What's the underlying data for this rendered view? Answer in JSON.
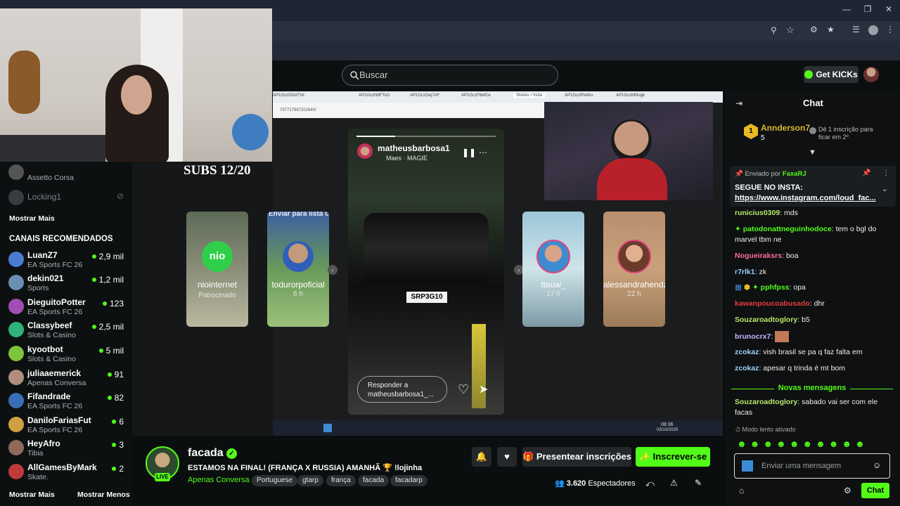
{
  "header": {
    "search_placeholder": "Buscar",
    "get_kicks": "Get KICKs"
  },
  "overlay": {
    "subs": "SUBS 12/20"
  },
  "sidebar": {
    "top_items": [
      {
        "name": "",
        "game": "Assetto Corsa"
      },
      {
        "name": "Locking1",
        "game": ""
      }
    ],
    "show_more_top": "Mostrar Mais",
    "recommended_title": "CANAIS RECOMENDADOS",
    "channels": [
      {
        "name": "LuanZ7",
        "game": "EA Sports FC 26",
        "viewers": "2,9 mil",
        "color": "#4a7bd0"
      },
      {
        "name": "dekin021",
        "game": "Sports",
        "viewers": "1,2 mil",
        "color": "#6b8fb3"
      },
      {
        "name": "DieguitoPotter",
        "game": "EA Sports FC 26",
        "viewers": "123",
        "color": "#a04eb5"
      },
      {
        "name": "Classybeef",
        "game": "Slots & Casino",
        "viewers": "2,5 mil",
        "color": "#2fb37a"
      },
      {
        "name": "kyootbot",
        "game": "Slots & Casino",
        "viewers": "5 mil",
        "color": "#7cc43a"
      },
      {
        "name": "juliaaemerick",
        "game": "Apenas Conversa",
        "viewers": "91",
        "color": "#b08d7c"
      },
      {
        "name": "Fifandrade",
        "game": "EA Sports FC 26",
        "viewers": "82",
        "color": "#3a6fb8"
      },
      {
        "name": "DaniloFariasFut",
        "game": "EA Sports FC 26",
        "viewers": "6",
        "color": "#d0a040"
      },
      {
        "name": "HeyAfro",
        "game": "Tibia",
        "viewers": "3",
        "color": "#8f6a5a"
      },
      {
        "name": "AllGamesByMark",
        "game": "Skate.",
        "viewers": "2",
        "color": "#c13a3a"
      }
    ],
    "show_more": "Mostrar Mais",
    "show_less": "Mostrar Menos"
  },
  "capture": {
    "tabs": [
      "AP1GczOOd7Vk",
      "AP1GczN8FTsO",
      "AP1GczOej7AF",
      "AP1GczF8efCe",
      "Stories • Insta",
      "AP1GczRVeKu",
      "AP1GczMNogk"
    ],
    "url": "797717967202640/",
    "stories": [
      {
        "name": "niointernet",
        "sub": "Patrocinado",
        "logo": "nio"
      },
      {
        "name": "todurorpoficial",
        "sub": "6 h",
        "top": "Enviar para lista c"
      },
      {
        "name": "tteuw_",
        "sub": "17 h"
      },
      {
        "name": "alessandrahendz",
        "sub": "22 h"
      }
    ],
    "center": {
      "user": "matheusbarbosa1",
      "song": "Maes · MAGIE",
      "reply": "Responder a matheusbarbosa1_...",
      "plate": "SRP3G10"
    },
    "clock": "08:36",
    "date": "03/10/2025"
  },
  "stream": {
    "channel": "facada",
    "title": "ESTAMOS NA FINAL! (FRANÇA X RUSSIA) AMANHÃ 🏆 !lojinha",
    "category": "Apenas Conversa",
    "tags": [
      "Portuguese",
      "gtarp",
      "frança",
      "facada",
      "facadarp"
    ],
    "live": "LIVE",
    "gift_label": "Presentear inscrições",
    "subscribe_label": "Inscrever-se",
    "viewers_count": "3.620",
    "viewers_label": "Espectadores"
  },
  "chat": {
    "title": "Chat",
    "top_sub": {
      "name": "Annderson7",
      "count": "5",
      "note": "Dê 1 inscrição para ficar em 2º"
    },
    "pinned": {
      "sent_by": "Enviado por",
      "user": "FaxaRJ",
      "text": "SEGUE NO INSTA:",
      "link": "https://www.instagram.com/loud_fac..."
    },
    "messages": [
      {
        "user": "runicius0309",
        "text": "mds",
        "color": "#b7e86a"
      },
      {
        "user": "patodonattneguinhodoce",
        "text": "tem o bgl do marvel tbm ne",
        "color": "#53fc18"
      },
      {
        "user": "Nogueiraksrs",
        "text": "boa",
        "color": "#ff6b9a"
      },
      {
        "user": "r7rlk1",
        "text": "zk",
        "color": "#9ad3ff"
      },
      {
        "user": "pphfpss",
        "text": "opa",
        "color": "#53fc18"
      },
      {
        "user": "kawanpoucoabusado",
        "text": "dhr",
        "color": "#e63c3c"
      },
      {
        "user": "Souzaroadtoglory",
        "text": "b5",
        "color": "#b7e86a"
      },
      {
        "user": "brunocrx7",
        "text": "",
        "color": "#c6b3ff"
      },
      {
        "user": "zcokaz",
        "text": "vish brasil se pa q faz falta em",
        "color": "#9ad3ff"
      },
      {
        "user": "zcokaz",
        "text": "apesar q trinda é mt bom",
        "color": "#9ad3ff"
      }
    ],
    "new_messages": "Novas mensagens",
    "last_message": {
      "user": "Souzaroadtoglory",
      "text": "sabado vai ser com ele facas",
      "color": "#b7e86a"
    },
    "slow_mode": "Modo lento ativado",
    "input_placeholder": "Enviar uma mensagem",
    "send_label": "Chat"
  }
}
